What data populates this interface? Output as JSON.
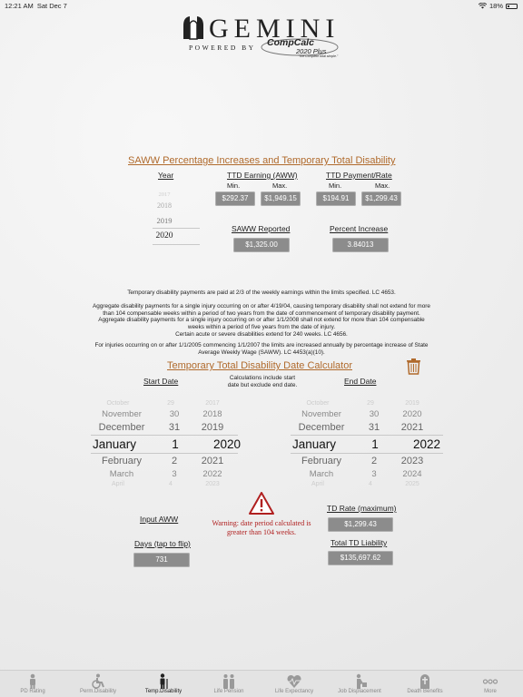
{
  "status": {
    "time": "12:21 AM",
    "date": "Sat Dec 7",
    "battery": "18%"
  },
  "logo": {
    "word": "GEMINI",
    "powered_by": "POWERED BY",
    "compcalc": "CompCalc",
    "version": "2020 Plus",
    "tagline": "\"The Complete total simple.\""
  },
  "saww": {
    "title": "SAWW Percentage Increases and Temporary Total Disability",
    "year_label": "Year",
    "years": [
      "2017",
      "2018",
      "2019",
      "2020"
    ],
    "ttd_earning_label": "TTD Earning (AWW)",
    "ttd_payment_label": "TTD Payment/Rate",
    "min_label": "Min.",
    "max_label": "Max.",
    "earning_min": "$292.37",
    "earning_max": "$1,949.15",
    "payment_min": "$194.91",
    "payment_max": "$1,299.43",
    "saww_reported_label": "SAWW Reported",
    "saww_reported": "$1,325.00",
    "percent_increase_label": "Percent Increase",
    "percent_increase": "3.84013"
  },
  "info": {
    "p1": "Temporary disability payments are paid at 2/3 of the weekly earnings within the limits specified. LC 4653.",
    "p2a": "Aggregate disability payments for a single injury occurring on or after 4/19/04, causing temporary disability shall not extend for more",
    "p2b": "than 104 compensable weeks within a period of two years from the date of commencement of temporary disability payment.",
    "p2c": "Aggregate disability payments for a single injury occurring on or after 1/1/2008 shall not extend for more than 104 compensable",
    "p2d": "weeks within a period of five years from the date of injury.",
    "p2e": "Certain acute or severe disabilities extend for 240 weeks. LC 4656.",
    "p3a": "For injuries occurring on or after 1/1/2005 commencing 1/1/2007 the limits are increased annually by percentage increase of State",
    "p3b": "Average Weekly Wage (SAWW). LC 4453(a)(10)."
  },
  "calc": {
    "title": "Temporary Total Disability Date Calculator",
    "start_label": "Start Date",
    "end_label": "End Date",
    "note_a": "Calculations include start",
    "note_b": "date but exclude end date.",
    "start_picker": [
      [
        "October",
        "29",
        "2017"
      ],
      [
        "November",
        "30",
        "2018"
      ],
      [
        "December",
        "31",
        "2019"
      ],
      [
        "January",
        "1",
        "2020"
      ],
      [
        "February",
        "2",
        "2021"
      ],
      [
        "March",
        "3",
        "2022"
      ],
      [
        "April",
        "4",
        "2023"
      ]
    ],
    "end_picker": [
      [
        "October",
        "29",
        "2019"
      ],
      [
        "November",
        "30",
        "2020"
      ],
      [
        "December",
        "31",
        "2021"
      ],
      [
        "January",
        "1",
        "2022"
      ],
      [
        "February",
        "2",
        "2023"
      ],
      [
        "March",
        "3",
        "2024"
      ],
      [
        "April",
        "4",
        "2025"
      ]
    ],
    "input_aww_label": "Input AWW",
    "days_label": "Days (tap to flip)",
    "days_value": "731",
    "warning_a": "Warning: date period calculated is",
    "warning_b": "greater than 104 weeks.",
    "td_rate_label": "TD Rate (maximum)",
    "td_rate_value": "$1,299.43",
    "total_td_label": "Total TD Liability",
    "total_td_value": "$135,697.62"
  },
  "tabs": [
    {
      "label": "PD Rating",
      "icon": "person-icon"
    },
    {
      "label": "Perm.Disability",
      "icon": "wheelchair-icon"
    },
    {
      "label": "Temp.Disability",
      "icon": "crutch-person-icon"
    },
    {
      "label": "Life Pension",
      "icon": "couple-icon"
    },
    {
      "label": "Life Expectancy",
      "icon": "heartbeat-icon"
    },
    {
      "label": "Job Displacement",
      "icon": "worker-icon"
    },
    {
      "label": "Death Benefits",
      "icon": "tombstone-icon"
    },
    {
      "label": "More",
      "icon": "more-dots-icon"
    }
  ],
  "colors": {
    "accent": "#b06a2c",
    "warning": "#b02020",
    "chip": "#8c8c8c"
  }
}
